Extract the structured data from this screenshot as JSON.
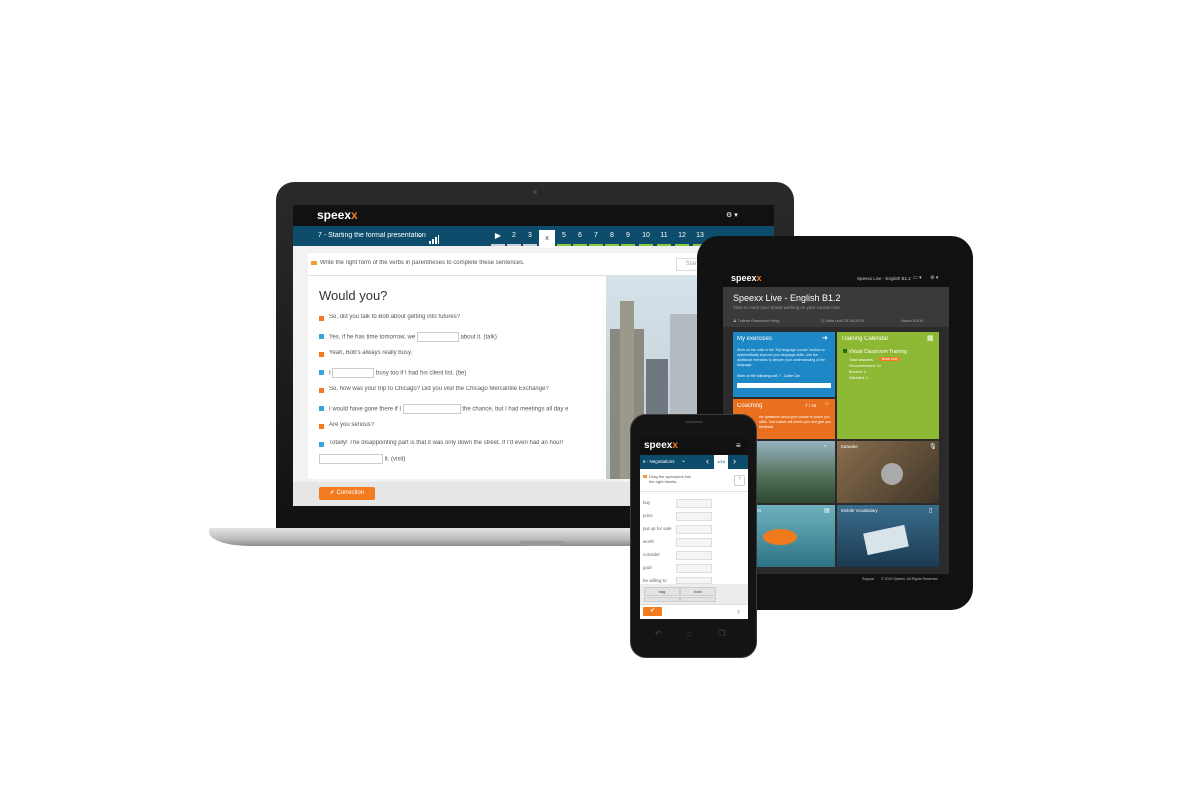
{
  "brand": {
    "name": "speex",
    "accent": "x",
    "accent_color": "#f47b20",
    "nav_color": "#0d4d6b"
  },
  "laptop": {
    "lesson_title": "7 - Starting the formal presentation",
    "nav_numbers": [
      "2",
      "3",
      "x",
      "5",
      "6",
      "7",
      "8",
      "9",
      "10",
      "11",
      "12",
      "13"
    ],
    "instruction": "Write the right form of the verbs in parentheses to complete these sentences.",
    "start_btn": "Start",
    "heading": "Would you?",
    "lines": [
      {
        "pre": "So, did you talk to Bob about getting into futures?",
        "post": ""
      },
      {
        "pre": "Yes, if he has time tomorrow, we",
        "post": "about it. (talk)"
      },
      {
        "pre": "Yeah, Bob's always really busy.",
        "post": ""
      },
      {
        "pre": "I",
        "post": "busy too if I had his client list. (be)"
      },
      {
        "pre": "So, how was your trip to Chicago? Did you visit the Chicago Mercantile Exchange?",
        "post": ""
      },
      {
        "pre": "I would have gone there if I",
        "post": "the chance, but I had meetings all day e"
      },
      {
        "pre": "Are you serious?",
        "post": ""
      },
      {
        "pre": "Totally! The disappointing part is that it was only down the street.  If I'd even had an hour!",
        "post": ""
      }
    ],
    "last_line_post": "it. (visit)",
    "correction_btn": "Correction"
  },
  "tablet": {
    "header_right": "Speexx Live - English B1.2",
    "title": "Speexx Live - English B1.2",
    "subtitle": "Time to meet your Smart working on your course now.",
    "meta": {
      "trainer_label": "Trainer",
      "trainer": "Esmerson Helig",
      "valid_label": "Valid until",
      "valid": "23.08.2019",
      "hours_label": "Hours",
      "hours": "0/100"
    },
    "my_exercises": {
      "title": "My exercises",
      "text": "Work on the units in the \"My language course\" section to systematically improve your language skills. Use the additional exercises to deepen your understanding of the language.",
      "next": "Work on the following unit: 7 - Cable Car"
    },
    "training_calendar": {
      "title": "Training Calendar",
      "item": "Virtual Classroom Training",
      "rows": [
        "Total sessions",
        "Recommended: 12",
        "Booked: 0",
        "Attended: 0"
      ],
      "book": "Book now"
    },
    "coaching": {
      "title": "Coaching",
      "count": "7 / 16",
      "text": "the questions about your course to coach you skills. Your trainer will check your and give you feedback."
    },
    "karaoke": "Karaoke",
    "times_video": "Times video",
    "mobile_vocab": "Mobile Vocabulary",
    "footer_support": "Support",
    "footer_copy": "© 2019 Speexx. All Rights Reserved."
  },
  "phone": {
    "topic": "6 - Negotiations",
    "page": "1/18",
    "instruction": "Drag the synonyms into the right blanks.",
    "words": [
      "buy",
      "price",
      "put up for sale",
      "worth",
      "consider",
      "goal",
      "be willing to"
    ],
    "chips": [
      "bag",
      "bum"
    ]
  }
}
